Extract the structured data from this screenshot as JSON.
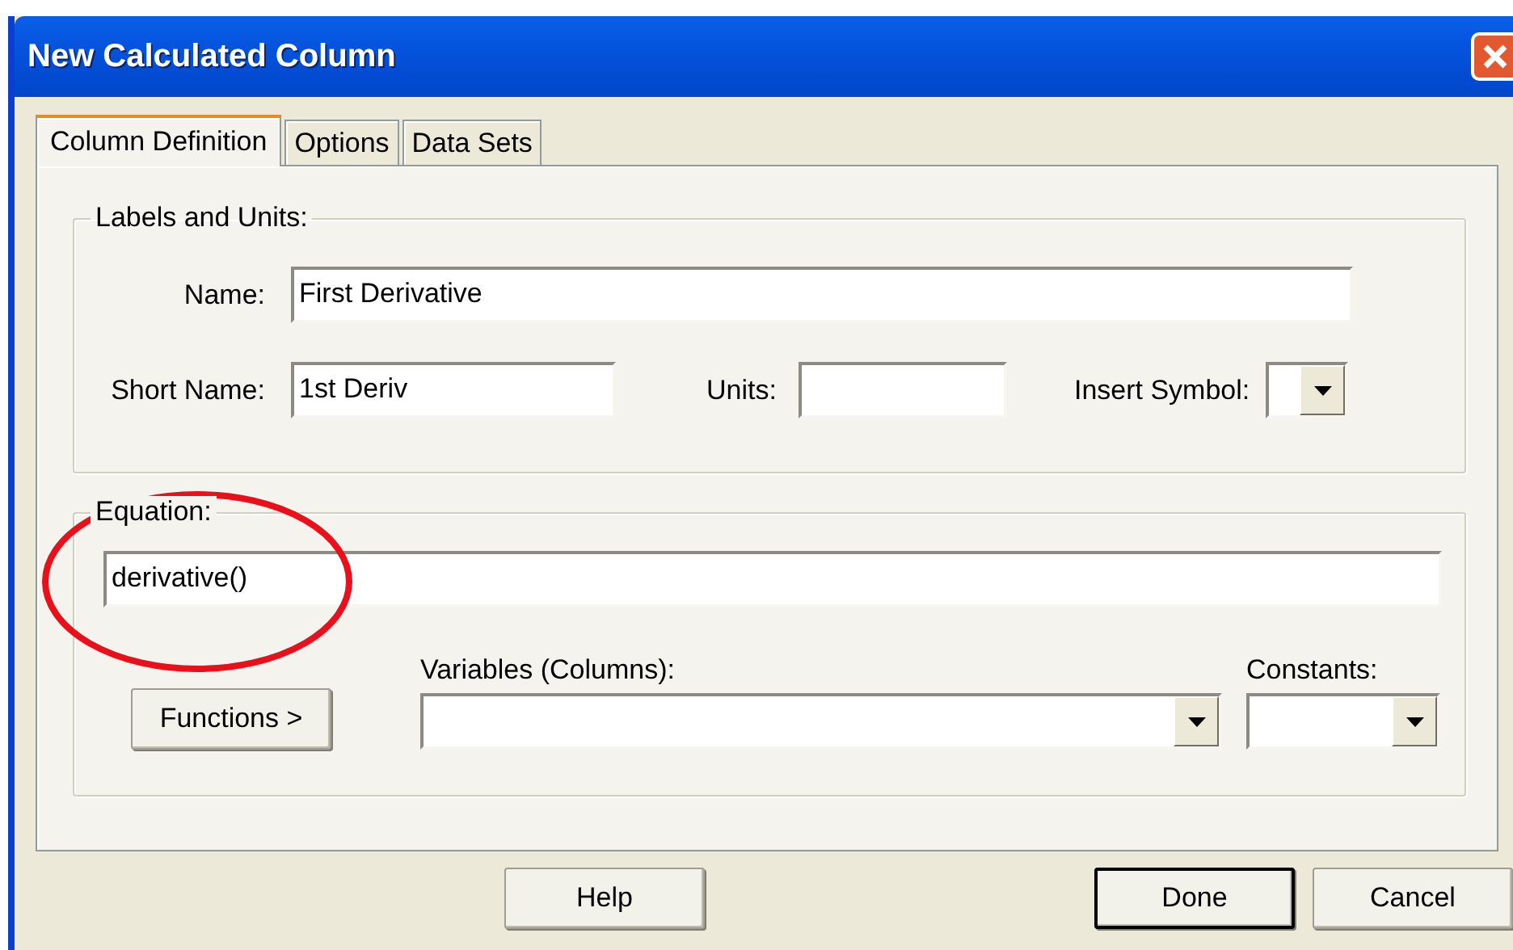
{
  "window": {
    "title": "New Calculated Column"
  },
  "tabs": [
    {
      "label": "Column Definition",
      "selected": true
    },
    {
      "label": "Options",
      "selected": false
    },
    {
      "label": "Data Sets",
      "selected": false
    }
  ],
  "labels_group": {
    "title": "Labels and Units:",
    "name": {
      "label": "Name:",
      "value": "First Derivative"
    },
    "short_name": {
      "label": "Short Name:",
      "value": "1st Deriv"
    },
    "units": {
      "label": "Units:"
    },
    "insert_symbol": {
      "label": "Insert Symbol:"
    }
  },
  "equation_group": {
    "title": "Equation:",
    "value": "derivative()",
    "functions_button": "Functions >",
    "variables": {
      "label": "Variables (Columns):"
    },
    "constants": {
      "label": "Constants:"
    }
  },
  "annotation": {
    "kind": "ellipse"
  },
  "buttons": [
    {
      "label": "Help",
      "default": false
    },
    {
      "label": "Done",
      "default": true
    },
    {
      "label": "Cancel",
      "default": false
    }
  ]
}
